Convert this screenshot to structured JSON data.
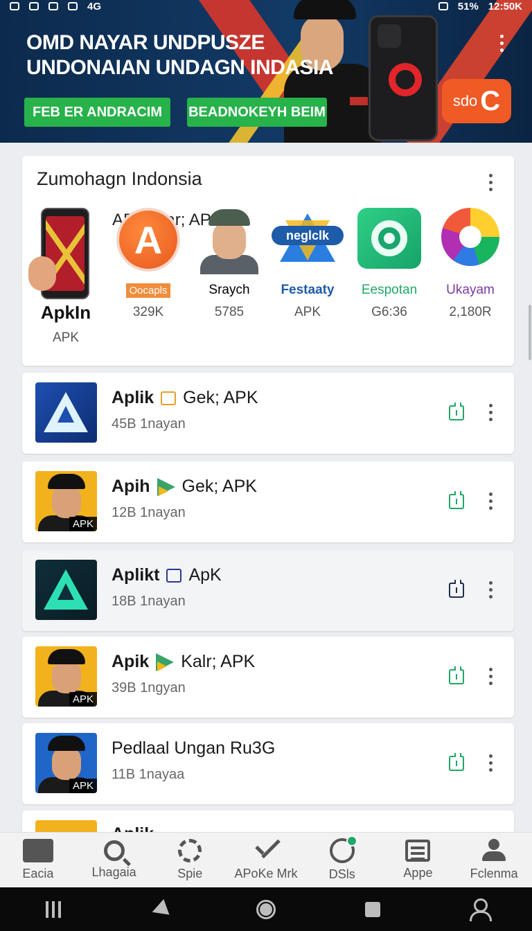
{
  "status_bar": {
    "signal": "4G",
    "battery": "51%",
    "time": "12:50K"
  },
  "banner": {
    "title_line1": "OMD NAYAR UNDPUSZE",
    "title_line2": "UNDONAIAN UNDAGN INDASIA",
    "button1": "FEB ER ANDRACIM",
    "button2": "BEADNOKEYH BEIM",
    "brand_text": "sdo",
    "brand_glyph": "C"
  },
  "featured": {
    "title": "Zumohagn Indonsia",
    "subtitle": "APK Star; APK",
    "items": [
      {
        "name": "ApkIn",
        "meta": "APK"
      },
      {
        "logo_text": "A",
        "tag": "Oocapls",
        "meta": "329K"
      },
      {
        "name": "Sraych",
        "meta": "5785"
      },
      {
        "logo_text": "neglclk",
        "name": "Festaaty",
        "meta": "APK",
        "color": "#1e5ba8"
      },
      {
        "name": "Eespotan",
        "meta": "G6:36",
        "color": "#1fa866"
      },
      {
        "name": "Ukayam",
        "meta": "2,180R",
        "color": "#7b3aa0"
      }
    ]
  },
  "apps": [
    {
      "name": "Aplik",
      "suffix": "Gek; APK",
      "meta": "45B 1nayan"
    },
    {
      "name": "Apih",
      "suffix": "Gek; APK",
      "meta": "12B 1nayan",
      "tag": "APK"
    },
    {
      "name": "Aplikt",
      "suffix": "ApK",
      "meta": "18B 1nayan"
    },
    {
      "name": "Apik",
      "suffix": "Kalr; APK",
      "meta": "39B 1ngyan",
      "tag": "APK"
    },
    {
      "name": "Pedlaal Ungan Ru3G",
      "suffix": "",
      "meta": "11B 1nayaa",
      "tag": "APK"
    },
    {
      "name": "Aplik",
      "suffix": "Gek",
      "meta": ""
    }
  ],
  "nav": {
    "items": [
      {
        "label": "Eacia",
        "icon": "bag-icon"
      },
      {
        "label": "Lhagaia",
        "icon": "search-icon"
      },
      {
        "label": "Spie",
        "icon": "flower-icon"
      },
      {
        "label": "APoKe Mrk",
        "icon": "check-icon"
      },
      {
        "label": "DSls",
        "icon": "ring-icon"
      },
      {
        "label": "Appe",
        "icon": "news-icon"
      },
      {
        "label": "Fclenma",
        "icon": "person-icon"
      }
    ]
  },
  "colors": {
    "accent_green": "#27b24a",
    "banner_bg": "#0c2a4d",
    "brand_orange": "#f05a24"
  }
}
